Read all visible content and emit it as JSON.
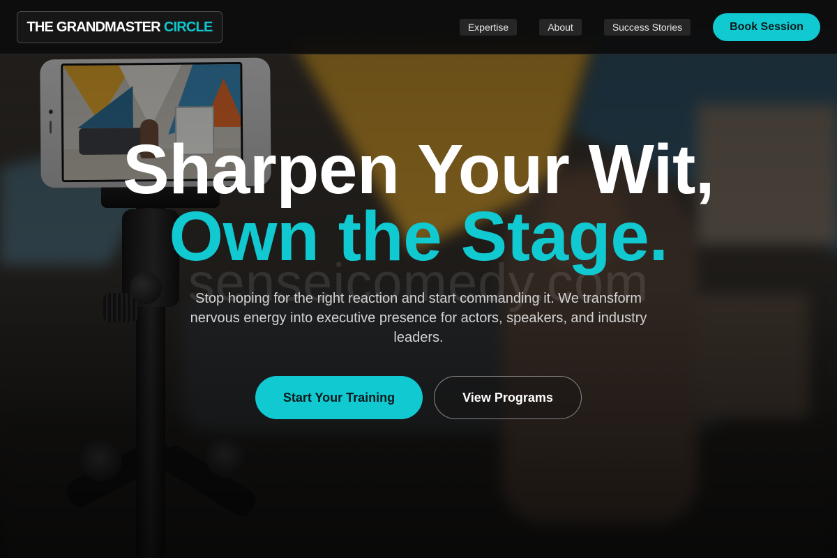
{
  "nav": {
    "logo_main": "THE GRANDMASTER",
    "logo_accent": "CIRCLE",
    "links": [
      {
        "label": "Expertise"
      },
      {
        "label": "About"
      },
      {
        "label": "Success Stories"
      }
    ],
    "cta_label": "Book Session"
  },
  "hero": {
    "headline_line1": "Sharpen Your Wit,",
    "headline_line2": "Own the Stage.",
    "watermark": "senseicomedy.com",
    "subtext": "Stop hoping for the right reaction and start commanding it. We transform nervous energy into executive presence for actors, speakers, and industry leaders.",
    "primary_cta": "Start Your Training",
    "secondary_cta": "View Programs"
  },
  "colors": {
    "accent": "#11c9d1",
    "nav_background": "#0c0c0c",
    "text_primary": "#ffffff"
  }
}
